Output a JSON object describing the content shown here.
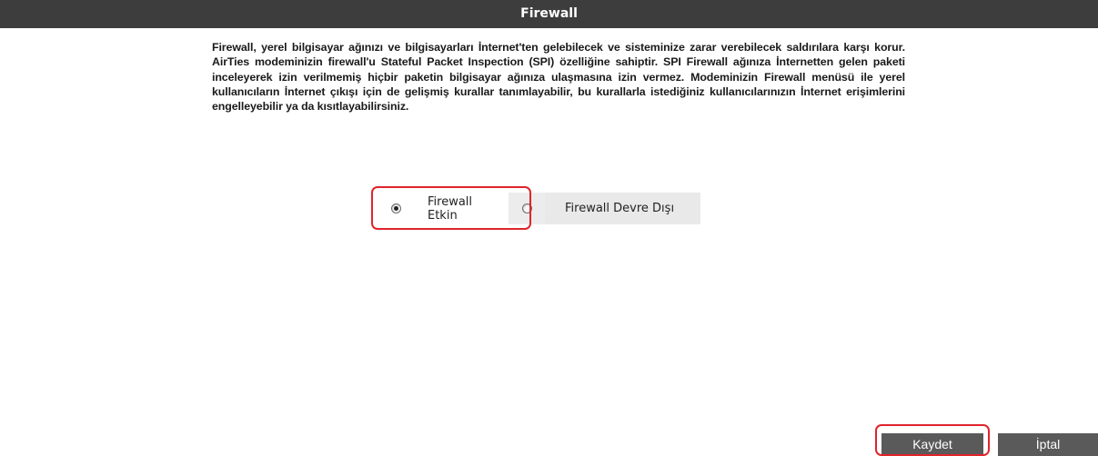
{
  "header": {
    "title": "Firewall"
  },
  "description": "Firewall, yerel bilgisayar ağınızı ve bilgisayarları İnternet'ten gelebilecek ve sisteminize zarar verebilecek saldırılara karşı korur. AirTies modeminizin firewall'u Stateful Packet Inspection (SPI) özelliğine sahiptir. SPI Firewall ağınıza İnternetten gelen paketi inceleyerek izin verilmemiş hiçbir paketin bilgisayar ağınıza ulaşmasına izin vermez. Modeminizin Firewall menüsü ile yerel kullanıcıların İnternet çıkışı için de gelişmiş kurallar tanımlayabilir, bu kurallarla istediğiniz kullanıcılarınızın İnternet erişimlerini engelleyebilir ya da kısıtlayabilirsiniz.",
  "firewall_mode": {
    "options": [
      {
        "label": "Firewall Etkin",
        "checked": true
      },
      {
        "label": "Firewall Devre Dışı",
        "checked": false
      }
    ]
  },
  "buttons": {
    "save_label": "Kaydet",
    "cancel_label": "İptal"
  },
  "colors": {
    "title_bar": "#3d3d3d",
    "button": "#5a5a5a",
    "highlight": "#e0242b"
  }
}
